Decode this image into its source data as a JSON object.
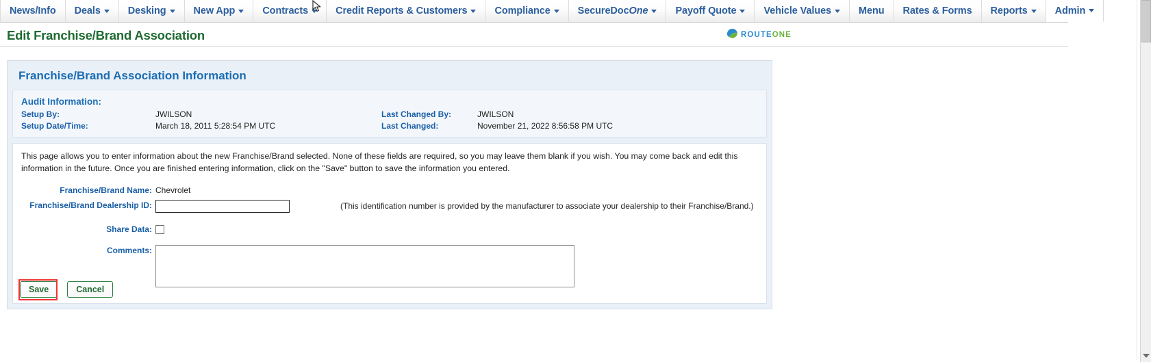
{
  "nav": {
    "items": [
      {
        "label": "News/Info",
        "has_caret": false,
        "active": false
      },
      {
        "label": "Deals",
        "has_caret": true,
        "active": false
      },
      {
        "label": "Desking",
        "has_caret": true,
        "active": false
      },
      {
        "label": "New App",
        "has_caret": true,
        "active": false
      },
      {
        "label": "Contracts",
        "has_caret": true,
        "active": false
      },
      {
        "label": "Credit Reports & Customers",
        "has_caret": true,
        "active": false
      },
      {
        "label": "Compliance",
        "has_caret": true,
        "active": false
      },
      {
        "label": "SecureDocOne",
        "label_main": "SecureDoc",
        "label_italic": "One",
        "has_caret": true,
        "active": false
      },
      {
        "label": "Payoff Quote",
        "has_caret": true,
        "active": false
      },
      {
        "label": "Vehicle Values",
        "has_caret": true,
        "active": false
      },
      {
        "label": "Menu",
        "has_caret": false,
        "active": false
      },
      {
        "label": "Rates & Forms",
        "has_caret": false,
        "active": false
      },
      {
        "label": "Reports",
        "has_caret": true,
        "active": false
      },
      {
        "label": "Admin",
        "has_caret": true,
        "active": true
      }
    ]
  },
  "header": {
    "page_title": "Edit Franchise/Brand Association",
    "logo": {
      "text_primary": "ROUTE",
      "text_secondary": "ONE",
      "icon": "routeone-swoosh-icon"
    }
  },
  "panel": {
    "title": "Franchise/Brand Association Information",
    "audit": {
      "heading": "Audit Information:",
      "setup_by_label": "Setup By:",
      "setup_by_value": "JWILSON",
      "setup_datetime_label": "Setup Date/Time:",
      "setup_datetime_value": "March 18, 2011 5:28:54 PM UTC",
      "last_changed_by_label": "Last Changed By:",
      "last_changed_by_value": "JWILSON",
      "last_changed_label": "Last Changed:",
      "last_changed_value": "November 21, 2022 8:56:58 PM UTC"
    },
    "intro_text": "This page allows you to enter information about the new Franchise/Brand selected. None of these fields are required, so you may leave them blank if you wish. You may come back and edit this information in the future. Once you are finished entering information, click on the \"Save\" button to save the information you entered.",
    "form": {
      "brand_name_label": "Franchise/Brand Name:",
      "brand_name_value": "Chevrolet",
      "dealership_id_label": "Franchise/Brand Dealership ID:",
      "dealership_id_value": "",
      "dealership_id_placeholder": "",
      "dealership_id_hint": "(This identification number is provided by the manufacturer to associate your dealership to their Franchise/Brand.)",
      "share_data_label": "Share Data:",
      "share_data_checked": false,
      "comments_label": "Comments:",
      "comments_value": "",
      "comments_placeholder": ""
    },
    "buttons": {
      "save_label": "Save",
      "cancel_label": "Cancel"
    }
  },
  "colors": {
    "nav_link": "#2c5f9e",
    "page_title_green": "#1f6b31",
    "panel_title_blue": "#1a6db5",
    "label_blue": "#1a5fa8",
    "highlight_red": "#f03434",
    "logo_blue": "#2b8ccd",
    "logo_green": "#6cb33f"
  }
}
